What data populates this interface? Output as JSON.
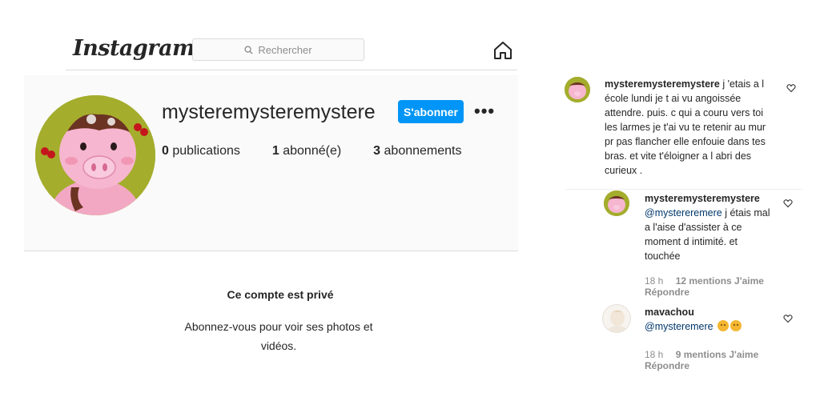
{
  "header": {
    "logo_text": "Instagram",
    "search_placeholder": "Rechercher",
    "home_icon": "home-icon"
  },
  "profile": {
    "username": "mysteremysteremystere",
    "follow_label": "S'abonner",
    "more_label": "•••",
    "stats": [
      {
        "count": "0",
        "label": "publications"
      },
      {
        "count": "1",
        "label": "abonné(e)"
      },
      {
        "count": "3",
        "label": "abonnements"
      }
    ],
    "private_title": "Ce compte est privé",
    "private_text": "Abonnez-vous pour voir ses photos et vidéos."
  },
  "comments": [
    {
      "user": "mysteremysteremystere",
      "text": "j 'etais a l école lundi je t ai vu angoissée attendre. puis. c qui a couru vers toi les larmes je t'ai vu te retenir au mur pr pas flancher elle enfouie dans tes bras. et vite t'éloigner a l abri des curieux ."
    },
    {
      "user": "mysteremysteremystere",
      "mention": "@mystereremere",
      "text": "j étais mal a l'aise d'assister à ce moment d intimité. et touchée",
      "time": "18 h",
      "likes": "12 mentions J'aime",
      "reply": "Répondre"
    },
    {
      "user": "mavachou",
      "mention": "@mysteremere",
      "time": "18 h",
      "likes": "9 mentions J'aime",
      "reply": "Répondre"
    }
  ]
}
